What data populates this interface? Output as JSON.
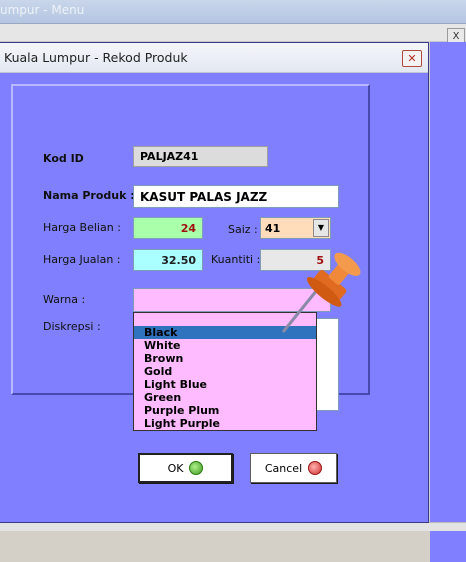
{
  "background_window": {
    "title": "umpur - Menu",
    "close_label": "X"
  },
  "dialog": {
    "title": "Kuala Lumpur - Rekod Produk",
    "close_label": "✕"
  },
  "form": {
    "kod_id": {
      "label": "Kod ID",
      "value": "PALJAZ41"
    },
    "nama_produk": {
      "label": "Nama Produk :",
      "value": "KASUT PALAS JAZZ"
    },
    "harga_belian": {
      "label": "Harga Belian :",
      "value": "24"
    },
    "harga_jualan": {
      "label": "Harga Jualan :",
      "value": "32.50"
    },
    "saiz": {
      "label": "Saiz :",
      "value": "41"
    },
    "kuantiti": {
      "label": "Kuantiti :",
      "value": "5"
    },
    "warna": {
      "label": "Warna :",
      "value": ""
    },
    "diskrepsi": {
      "label": "Diskrepsi :",
      "value": ""
    }
  },
  "warna_dropdown": {
    "selected_index": 0,
    "options": [
      "Black",
      "White",
      "Brown",
      "Gold",
      "Light Blue",
      "Green",
      "Purple Plum",
      "Light Purple"
    ]
  },
  "buttons": {
    "ok": {
      "label": "OK",
      "icon": "check-icon"
    },
    "cancel": {
      "label": "Cancel",
      "icon": "cancel-icon"
    }
  },
  "colors": {
    "dialog_bg": "#7f7fff",
    "harga_belian_bg": "#aaffaa",
    "harga_jualan_bg": "#aaffff",
    "saiz_bg": "#ffddbb",
    "warna_bg": "#ffbbff",
    "selected_option": "#2f73bf",
    "pin": "#f07a2a"
  }
}
